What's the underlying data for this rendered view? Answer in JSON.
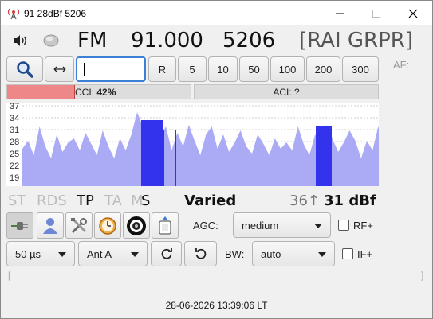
{
  "window": {
    "title": "91 28dBf 5206"
  },
  "header": {
    "band": "FM",
    "frequency": "91.000",
    "pi_code": "5206",
    "ps_name": "[RAI GRPR]",
    "af_label": "AF:"
  },
  "toolbar": {
    "freq_input_value": "",
    "step_buttons": [
      "R",
      "5",
      "10",
      "50",
      "100",
      "200",
      "300"
    ]
  },
  "meters": {
    "cci_label": "CCI:",
    "cci_value": "42%",
    "cci_level": 0.42,
    "aci_label": "ACI: ?"
  },
  "scan": {
    "y_axis": [
      "37",
      "34",
      "31",
      "28",
      "25",
      "22",
      "19"
    ],
    "fill_color": "#aaaaf5",
    "highlight_color": "#3333ee"
  },
  "rds": {
    "st": "ST",
    "rds": "RDS",
    "tp": "TP",
    "ta": "TA",
    "m": "M",
    "s": "S",
    "pty": "Varied",
    "signal_extra": "36↑",
    "signal": "31 dBf"
  },
  "controls": {
    "agc_label": "AGC:",
    "agc_value": "medium",
    "rf_label": "RF+",
    "deemphasis": "50 µs",
    "antenna": "Ant A",
    "bw_label": "BW:",
    "bw_value": "auto",
    "if_label": "IF+"
  },
  "status": {
    "bracket_left": "[",
    "bracket_right": "]",
    "clock": "28-06-2026 13:39:06 LT"
  }
}
